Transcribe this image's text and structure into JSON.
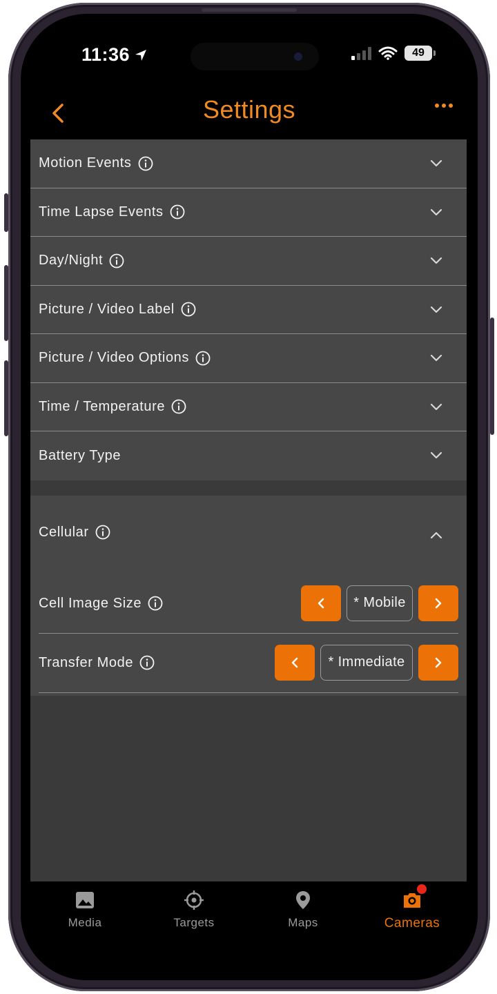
{
  "status_bar": {
    "time": "11:36",
    "battery": "49"
  },
  "nav": {
    "title": "Settings"
  },
  "sections": [
    {
      "label": "Motion Events",
      "has_info": true
    },
    {
      "label": "Time Lapse Events",
      "has_info": true
    },
    {
      "label": "Day/Night",
      "has_info": true
    },
    {
      "label": "Picture / Video Label",
      "has_info": true
    },
    {
      "label": "Picture / Video Options",
      "has_info": true
    },
    {
      "label": "Time / Temperature",
      "has_info": true
    },
    {
      "label": "Battery Type",
      "has_info": false
    }
  ],
  "cellular": {
    "title": "Cellular",
    "cell_image_size": {
      "label": "Cell Image Size",
      "value": "* Mobile"
    },
    "transfer_mode": {
      "label": "Transfer Mode",
      "value": "* Immediate"
    }
  },
  "tabs": [
    {
      "label": "Media",
      "icon": "image-icon"
    },
    {
      "label": "Targets",
      "icon": "crosshair-icon"
    },
    {
      "label": "Maps",
      "icon": "map-pin-icon"
    },
    {
      "label": "Cameras",
      "icon": "camera-icon",
      "active": true
    }
  ],
  "colors": {
    "accent": "#ec7207",
    "title": "#f08a24",
    "panel": "#474747",
    "badge": "#e8261a"
  }
}
